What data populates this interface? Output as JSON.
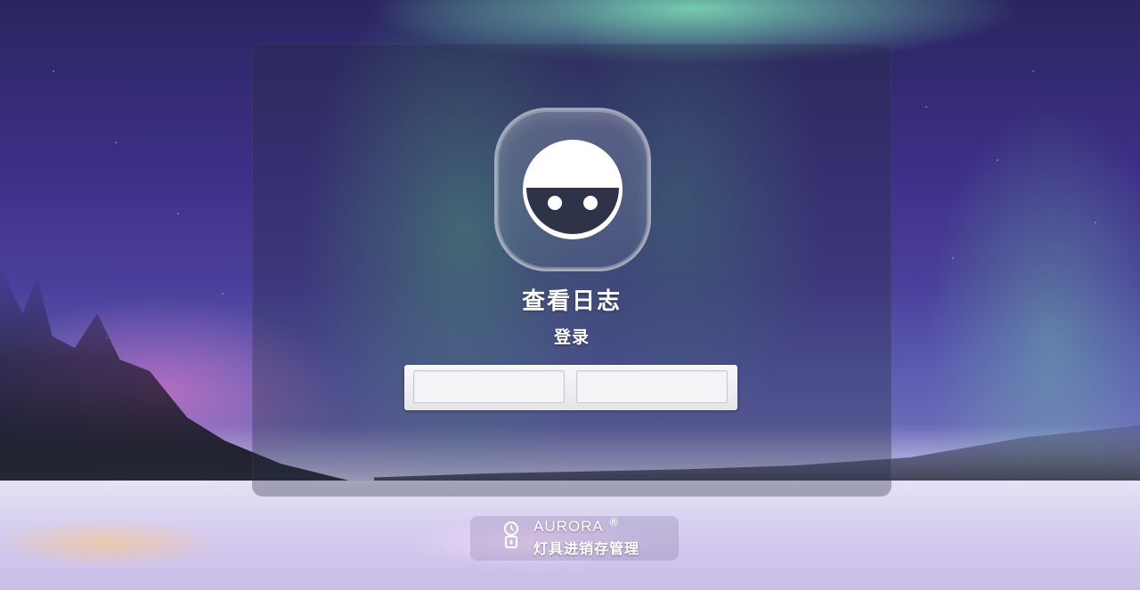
{
  "app": {
    "title": "查看日志",
    "login_label": "登录"
  },
  "form": {
    "username_value": "",
    "password_value": ""
  },
  "brand": {
    "name": "AURORA",
    "registered_mark": "®",
    "subtitle": "灯具进销存管理",
    "icon": "lamp-icon"
  },
  "avatar": {
    "icon": "user-avatar-icon"
  }
}
